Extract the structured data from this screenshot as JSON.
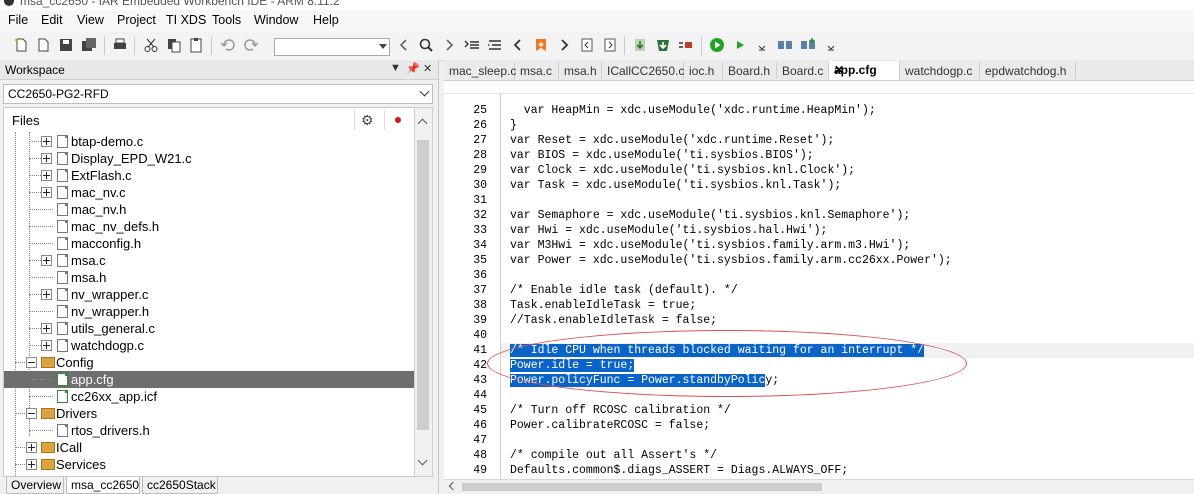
{
  "window": {
    "title": "msa_cc2650 - IAR Embedded Workbench IDE - ARM 8.11.2"
  },
  "menu": [
    "File",
    "Edit",
    "View",
    "Project",
    "TI XDS",
    "Tools",
    "Window",
    "Help"
  ],
  "workspace": {
    "title": "Workspace",
    "config": "CC2650-PG2-RFD",
    "files_header": "Files",
    "items": [
      {
        "label": "btap-demo.c"
      },
      {
        "label": "Display_EPD_W21.c"
      },
      {
        "label": "ExtFlash.c"
      },
      {
        "label": "mac_nv.c"
      },
      {
        "label": "mac_nv.h"
      },
      {
        "label": "mac_nv_defs.h"
      },
      {
        "label": "macconfig.h"
      },
      {
        "label": "msa.c"
      },
      {
        "label": "msa.h"
      },
      {
        "label": "nv_wrapper.c"
      },
      {
        "label": "nv_wrapper.h"
      },
      {
        "label": "utils_general.c"
      },
      {
        "label": "watchdogp.c"
      },
      {
        "label": "Config"
      },
      {
        "label": "app.cfg"
      },
      {
        "label": "cc26xx_app.icf"
      },
      {
        "label": "Drivers"
      },
      {
        "label": "rtos_drivers.h"
      },
      {
        "label": "ICall"
      },
      {
        "label": "Services"
      }
    ],
    "tabs": [
      "Overview",
      "msa_cc2650",
      "cc2650Stack"
    ]
  },
  "editor": {
    "tabs": [
      "mac_sleep.c",
      "msa.c",
      "msa.h",
      "ICallCC2650.c",
      "ioc.h",
      "Board.h",
      "Board.c",
      "app.cfg",
      "watchdogp.c",
      "epdwatchdog.h"
    ],
    "active_tab": "app.cfg",
    "lines": [
      {
        "n": "25",
        "text": "  var HeapMin = xdc.useModule('xdc.runtime.HeapMin');"
      },
      {
        "n": "26",
        "text": "}"
      },
      {
        "n": "27",
        "text": "var Reset = xdc.useModule('xdc.runtime.Reset');"
      },
      {
        "n": "28",
        "text": "var BIOS = xdc.useModule('ti.sysbios.BIOS');"
      },
      {
        "n": "29",
        "text": "var Clock = xdc.useModule('ti.sysbios.knl.Clock');"
      },
      {
        "n": "30",
        "text": "var Task = xdc.useModule('ti.sysbios.knl.Task');"
      },
      {
        "n": "31",
        "text": ""
      },
      {
        "n": "32",
        "text": "var Semaphore = xdc.useModule('ti.sysbios.knl.Semaphore');"
      },
      {
        "n": "33",
        "text": "var Hwi = xdc.useModule('ti.sysbios.hal.Hwi');"
      },
      {
        "n": "34",
        "text": "var M3Hwi = xdc.useModule('ti.sysbios.family.arm.m3.Hwi');"
      },
      {
        "n": "35",
        "text": "var Power = xdc.useModule('ti.sysbios.family.arm.cc26xx.Power');"
      },
      {
        "n": "36",
        "text": ""
      },
      {
        "n": "37",
        "text": "/* Enable idle task (default). */"
      },
      {
        "n": "38",
        "text": "Task.enableIdleTask = true;"
      },
      {
        "n": "39",
        "text": "//Task.enableIdleTask = false;"
      },
      {
        "n": "40",
        "text": ""
      },
      {
        "n": "41",
        "text": "/* Idle CPU when threads blocked waiting for an interrupt */"
      },
      {
        "n": "42",
        "text": "Power.idle = true;"
      },
      {
        "n": "43",
        "text": "Power.policyFunc = Power.standbyPolicy;"
      },
      {
        "n": "44",
        "text": ""
      },
      {
        "n": "45",
        "text": "/* Turn off RCOSC calibration */"
      },
      {
        "n": "46",
        "text": "Power.calibrateRCOSC = false;"
      },
      {
        "n": "47",
        "text": ""
      },
      {
        "n": "48",
        "text": "/* compile out all Assert's */"
      },
      {
        "n": "49",
        "text": "Defaults.common$.diags_ASSERT = Diags.ALWAYS_OFF;"
      }
    ],
    "selection_split": {
      "line41_sel": "/* Idle CPU when threads blocked waiting for an interrupt */",
      "line42_sel": "Power.idle = true;",
      "line43_sel": "Power.policyFunc = Power.standbyPolic",
      "line43_rest": "y;"
    }
  },
  "colors": {
    "selection": "#0a63c9",
    "annotation": "#e05050",
    "tree_selected": "#6e6e6e"
  }
}
